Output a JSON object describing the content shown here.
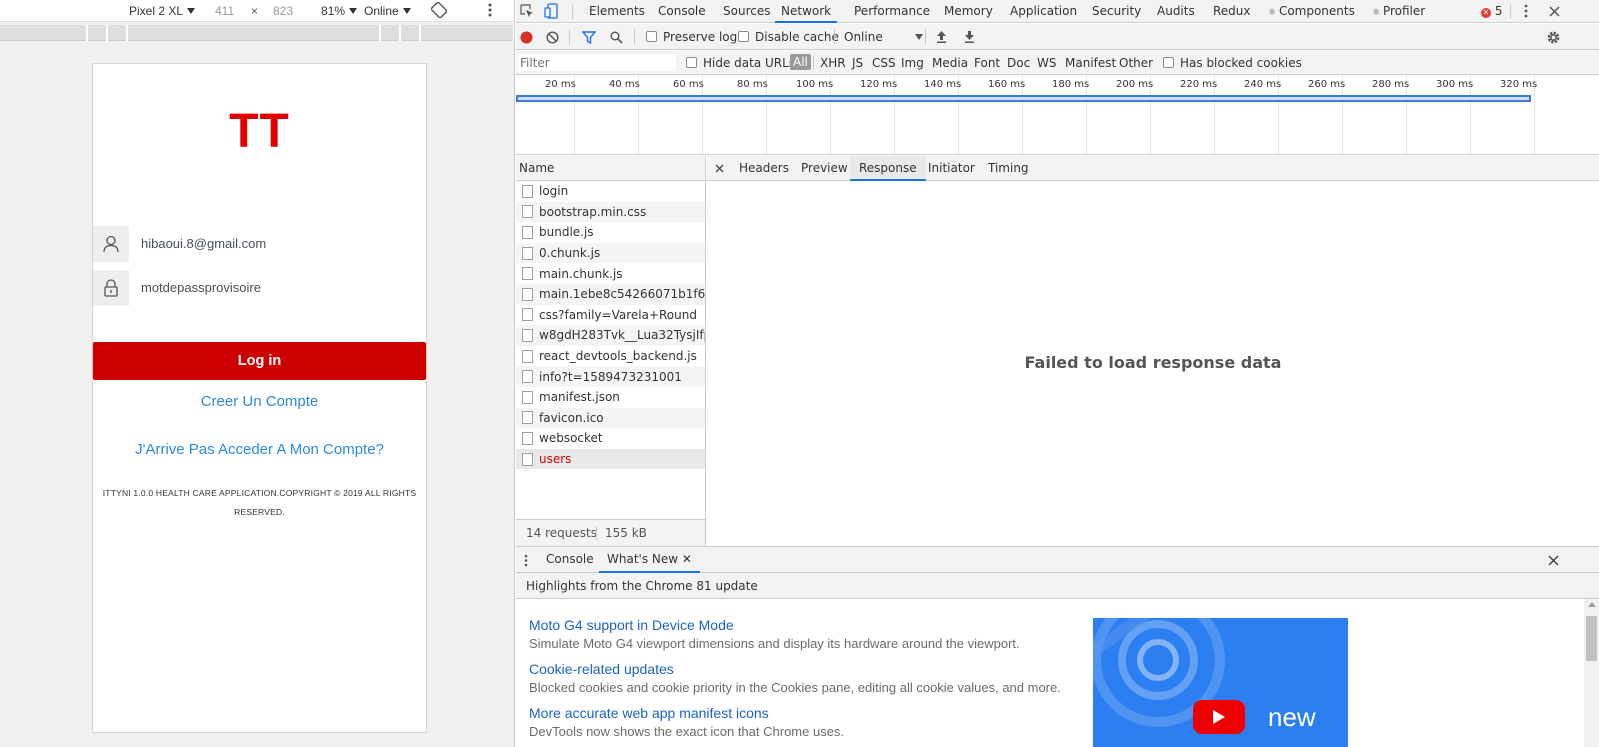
{
  "device_toolbar": {
    "device": "Pixel 2 XL",
    "width": "411",
    "times": "×",
    "height": "823",
    "zoom": "81%",
    "throttle": "Online"
  },
  "app": {
    "logo": "TT",
    "email_value": "hibaoui.8@gmail.com",
    "password_value": "motdepassprovisoire",
    "login_label": "Log in",
    "create_account_link": "Creer Un Compte",
    "cant_access_link": "J'Arrive Pas Acceder A Mon Compte?",
    "footer_text": "ITTYNI 1.0.0 HEALTH CARE APPLICATION.COPYRIGHT © 2019 ALL RIGHTS RESERVED.",
    "colors": {
      "brand_red": "#cc0000",
      "link_blue": "#2a8ae0"
    }
  },
  "devtools": {
    "tabs": [
      "Elements",
      "Console",
      "Sources",
      "Network",
      "Performance",
      "Memory",
      "Application",
      "Security",
      "Audits",
      "Redux",
      "Components",
      "Profiler"
    ],
    "active_tab": "Network",
    "component_prefix_icons": {
      "Components": "react-icon",
      "Profiler": "react-icon"
    },
    "error_count": "5",
    "network_toolbar": {
      "preserve_log": "Preserve log",
      "disable_cache": "Disable cache",
      "throttle": "Online"
    },
    "filter": {
      "placeholder": "Filter",
      "hide_data_urls": "Hide data URLs",
      "types": [
        "All",
        "XHR",
        "JS",
        "CSS",
        "Img",
        "Media",
        "Font",
        "Doc",
        "WS",
        "Manifest",
        "Other"
      ],
      "active_type": "All",
      "has_blocked_cookies": "Has blocked cookies"
    },
    "timeline": {
      "ticks": [
        "20 ms",
        "40 ms",
        "60 ms",
        "80 ms",
        "100 ms",
        "120 ms",
        "140 ms",
        "160 ms",
        "180 ms",
        "200 ms",
        "220 ms",
        "240 ms",
        "260 ms",
        "280 ms",
        "300 ms",
        "320 ms"
      ]
    },
    "requests": {
      "header": "Name",
      "items": [
        "login",
        "bootstrap.min.css",
        "bundle.js",
        "0.chunk.js",
        "main.chunk.js",
        "main.1ebe8c54266071b1f694....",
        "css?family=Varela+Round",
        "w8gdH283Tvk__Lua32TysjIfp8...",
        "react_devtools_backend.js",
        "info?t=1589473231001",
        "manifest.json",
        "favicon.ico",
        "websocket",
        "users"
      ],
      "failed_item": "users",
      "summary_requests": "14 requests",
      "summary_transferred": "155 kB transferred"
    },
    "detail": {
      "tabs": [
        "Headers",
        "Preview",
        "Response",
        "Initiator",
        "Timing"
      ],
      "active_tab": "Response",
      "message": "Failed to load response data"
    },
    "drawer": {
      "tabs": [
        "Console",
        "What's New"
      ],
      "active_tab": "What's New",
      "subtitle": "Highlights from the Chrome 81 update",
      "news": [
        {
          "title": "Moto G4 support in Device Mode",
          "desc": "Simulate Moto G4 viewport dimensions and display its hardware around the viewport."
        },
        {
          "title": "Cookie-related updates",
          "desc": "Blocked cookies and cookie priority in the Cookies pane, editing all cookie values, and more."
        },
        {
          "title": "More accurate web app manifest icons",
          "desc": "DevTools now shows the exact icon that Chrome uses."
        }
      ],
      "image_text": "new"
    },
    "accent_color": "#1a73e8"
  }
}
